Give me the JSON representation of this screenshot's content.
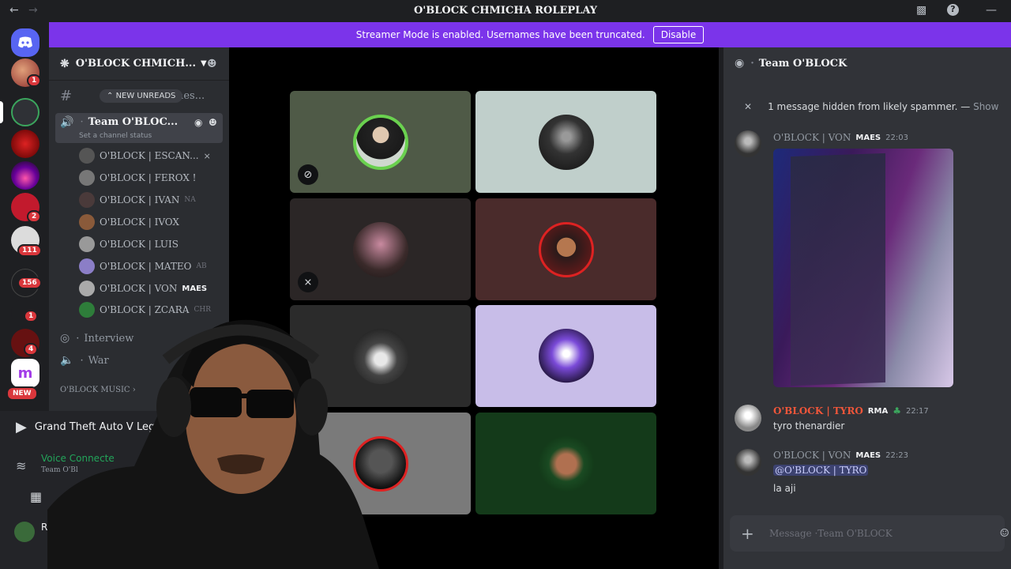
{
  "window": {
    "title": "O'BLOCK CHMICHA ROLEPLAY",
    "back_icon": "arrow-left",
    "forward_icon": "arrow-right"
  },
  "banner": {
    "text": "Streamer Mode is enabled. Usernames have been truncated.",
    "button": "Disable",
    "color": "#7b34ea"
  },
  "rail": {
    "badges": [
      "1",
      "2",
      "111",
      "156",
      "1",
      "4"
    ],
    "new_label": "NEW"
  },
  "sidebar": {
    "server_name": "O'BLOCK CHMICH...",
    "new_unreads": "NEW UNREADS",
    "partial_channel": "mes...",
    "active_channel": "Team O'BLOC...",
    "channel_status": "Set a channel status",
    "members": [
      {
        "name": "O'BLOCK | ESCAN...",
        "extra": ""
      },
      {
        "name": "O'BLOCK | FEROX !",
        "extra": ""
      },
      {
        "name": "O'BLOCK | IVAN",
        "extra": "NA"
      },
      {
        "name": "O'BLOCK | IVOX",
        "extra": ""
      },
      {
        "name": "O'BLOCK | LUIS",
        "extra": ""
      },
      {
        "name": "O'BLOCK | MATEO",
        "extra": "AB"
      },
      {
        "name": "O'BLOCK | VON",
        "extra": "MAES"
      },
      {
        "name": "O'BLOCK | ZCARA",
        "extra": "CHR"
      }
    ],
    "other_channels": [
      "Interview",
      "War"
    ],
    "category": "O'BLOCK MUSIC"
  },
  "user_panel": {
    "activity": "Grand Theft Auto V Legacy",
    "voice_status": "Voice Connecte",
    "voice_channel": "Team O'Bl",
    "username": "Rush"
  },
  "chat": {
    "channel": "Team O'BLOCK",
    "hidden_notice": "1 message hidden from likely spammer. —",
    "show_label": "Show",
    "messages": [
      {
        "author": "O'BLOCK | VON",
        "tag": "MAES",
        "time": "22:03",
        "text": "",
        "color": "#949ba4"
      },
      {
        "author": "O'BLOCK | TYRO",
        "tag": "RMA",
        "time": "22:17",
        "text": "tyro thenardier",
        "color": "#f0563a"
      },
      {
        "author": "O'BLOCK | VON",
        "tag": "MAES",
        "time": "22:23",
        "mention": "@O'BLOCK | TYRO",
        "text": "la aji",
        "color": "#949ba4"
      }
    ],
    "placeholder": "Message ·Team O'BLOCK"
  }
}
